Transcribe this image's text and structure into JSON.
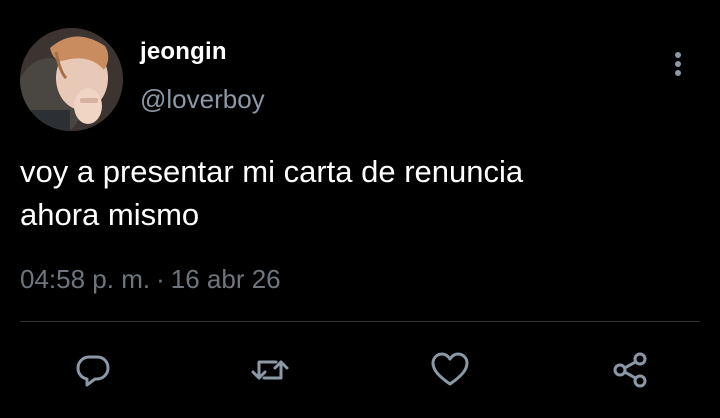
{
  "user": {
    "display_name": "jeongin",
    "handle": "@loverboy",
    "avatar_icon": "avatar-photo"
  },
  "tweet": {
    "text": "voy a presentar mi carta de renuncia\nahora mismo",
    "time": "04:58 p. m.",
    "separator": "·",
    "date": "16 abr 26"
  },
  "actions": {
    "reply_icon": "reply-icon",
    "retweet_icon": "retweet-icon",
    "like_icon": "heart-icon",
    "share_icon": "share-icon",
    "more_icon": "more-vertical-icon"
  },
  "colors": {
    "background": "#000000",
    "primary_text": "#ffffff",
    "secondary_text": "#8b98a5",
    "muted_text": "#6e767d",
    "icon": "#8b98a5",
    "divider": "#2f3336"
  }
}
